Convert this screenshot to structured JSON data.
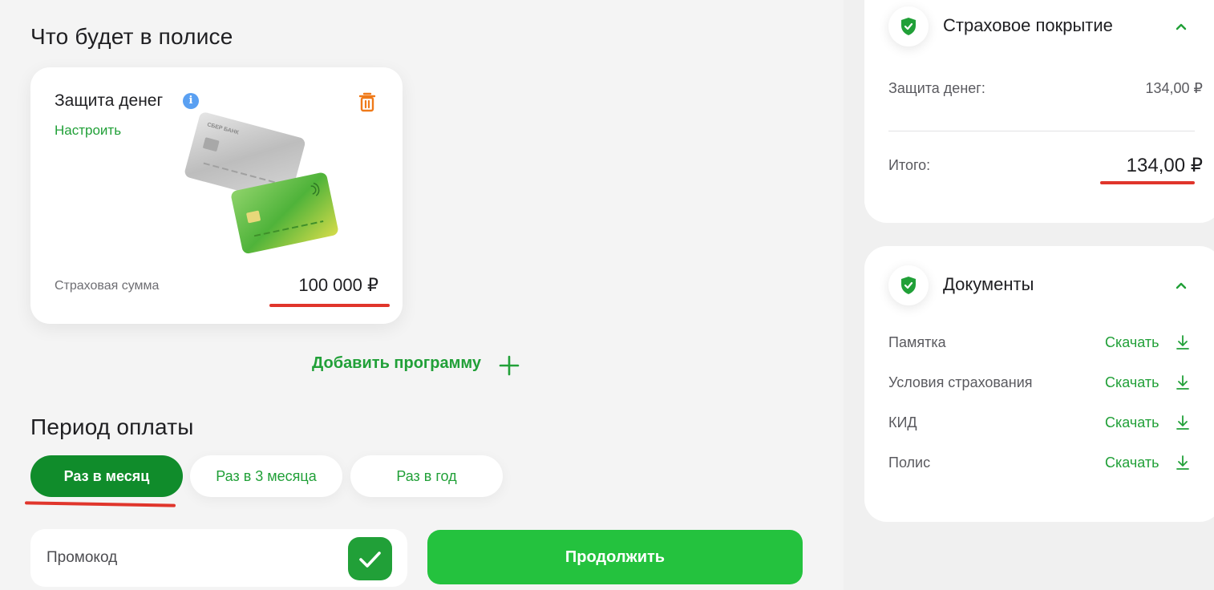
{
  "policy": {
    "title": "Что будет в полисе",
    "program": {
      "name": "Защита денег",
      "info_icon": "i",
      "configure_label": "Настроить",
      "card_brand": "СБЕР БАНК",
      "sum_label": "Страховая сумма",
      "sum_value": "100 000 ₽"
    },
    "add_program_label": "Добавить программу"
  },
  "period": {
    "title": "Период оплаты",
    "options": [
      {
        "label": "Раз в месяц",
        "selected": true
      },
      {
        "label": "Раз в 3 месяца",
        "selected": false
      },
      {
        "label": "Раз в год",
        "selected": false
      }
    ]
  },
  "promo": {
    "placeholder": "Промокод"
  },
  "continue_label": "Продолжить",
  "coverage": {
    "title": "Страховое покрытие",
    "rows": [
      {
        "label": "Защита денег:",
        "value": "134,00 ₽"
      }
    ],
    "total_label": "Итого:",
    "total_value": "134,00 ₽"
  },
  "documents": {
    "title": "Документы",
    "items": [
      {
        "name": "Памятка",
        "action": "Скачать"
      },
      {
        "name": "Условия страхования",
        "action": "Скачать"
      },
      {
        "name": "КИД",
        "action": "Скачать"
      },
      {
        "name": "Полис",
        "action": "Скачать"
      }
    ]
  },
  "colors": {
    "accent_green": "#21a038",
    "button_green": "#24c23e",
    "active_period": "#108c2b",
    "delete_orange": "#ef7a1a",
    "info_blue": "#5aa0f2",
    "highlight_red": "#e0352b"
  },
  "icons": {
    "info": "info-icon",
    "delete": "trash-icon",
    "add": "plus-icon",
    "promo_apply": "check-icon",
    "section": "shield-check-icon",
    "collapse": "chevron-up-icon",
    "download": "download-icon"
  }
}
